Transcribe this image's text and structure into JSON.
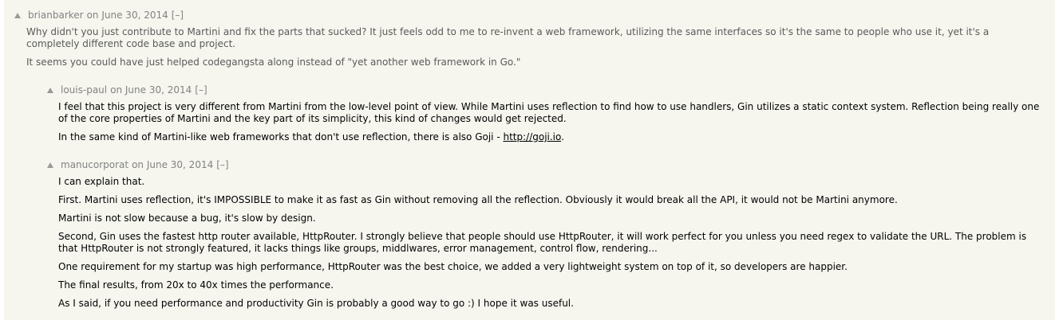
{
  "comments": [
    {
      "user": "brianbarker",
      "age": "on June 30, 2014",
      "toggle": "[–]",
      "paragraphs": [
        "Why didn't you just contribute to Martini and fix the parts that sucked? It just feels odd to me to re-invent a web framework, utilizing the same interfaces so it's the same to people who use it, yet it's a completely different code base and project.",
        "It seems you could have just helped codegangsta along instead of \"yet another web framework in Go.\""
      ]
    },
    {
      "user": "louis-paul",
      "age": "on June 30, 2014",
      "toggle": "[–]",
      "paragraphs": [
        "I feel that this project is very different from Martini from the low-level point of view. While Martini uses reflection to find how to use handlers, Gin utilizes a static context system. Reflection being really one of the core properties of Martini and the key part of its simplicity, this kind of changes would get rejected."
      ],
      "last_paragraph_prefix": "In the same kind of Martini-like web frameworks that don't use reflection, there is also Goji - ",
      "link_text": "http://goji.io",
      "last_paragraph_suffix": "."
    },
    {
      "user": "manucorporat",
      "age": "on June 30, 2014",
      "toggle": "[–]",
      "paragraphs": [
        "I can explain that.",
        "First. Martini uses reflection, it's IMPOSSIBLE to make it as fast as Gin without removing all the reflection. Obviously it would break all the API, it would not be Martini anymore.",
        "Martini is not slow because a bug, it's slow by design.",
        "Second, Gin uses the fastest http router available, HttpRouter. I strongly believe that people should use HttpRouter, it will work perfect for you unless you need regex to validate the URL. The problem is that HttpRouter is not strongly featured, it lacks things like groups, middlwares, error management, control flow, rendering...",
        "One requirement for my startup was high performance, HttpRouter was the best choice, we added a very lightweight system on top of it, so developers are happier.",
        "The final results, from 20x to 40x times the performance.",
        "As I said, if you need performance and productivity Gin is probably a good way to go :) I hope it was useful."
      ]
    }
  ]
}
